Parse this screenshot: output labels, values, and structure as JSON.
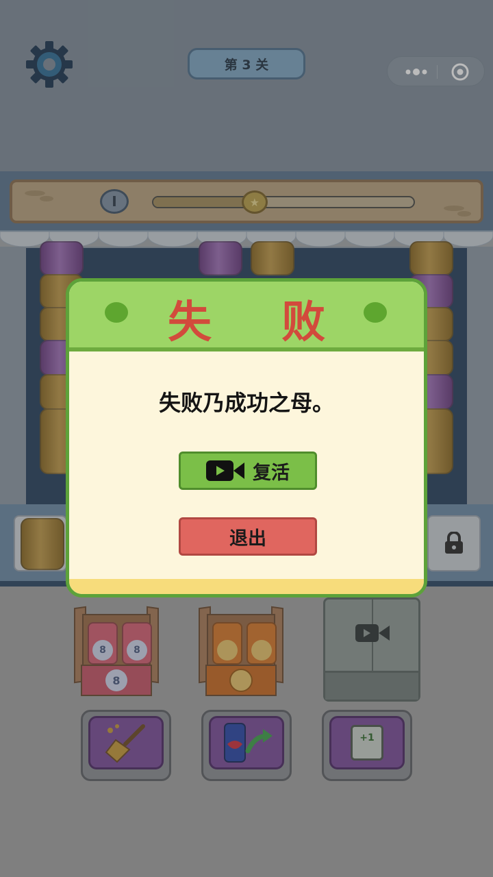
{
  "hud": {
    "level_label": "第 3 关",
    "settings_icon": "gear-icon",
    "menu_icon": "more-dots-icon",
    "close_icon": "target-circle-icon"
  },
  "progress": {
    "badge": "I",
    "value": 0.39,
    "marker_icon": "star-coin-icon"
  },
  "boosters": [
    {
      "name": "clean",
      "icon": "broom-icon"
    },
    {
      "name": "move",
      "icon": "can-arrow-icon"
    },
    {
      "name": "extra-slot",
      "label": "+1",
      "icon": "card-plus-icon"
    }
  ],
  "crates": [
    {
      "chip": "8",
      "color": "#e0667c"
    },
    {
      "chip": "◐",
      "color": "#e8852a"
    }
  ],
  "modal": {
    "title": "失 败",
    "message": "失败乃成功之母。",
    "revive_label": "复活",
    "exit_label": "退出",
    "revive_icon": "video-camera-icon"
  },
  "colors": {
    "modal_header": "#9dd566",
    "title_red": "#d24a3c",
    "revive_green": "#7bbf48",
    "exit_red": "#e0665f"
  }
}
